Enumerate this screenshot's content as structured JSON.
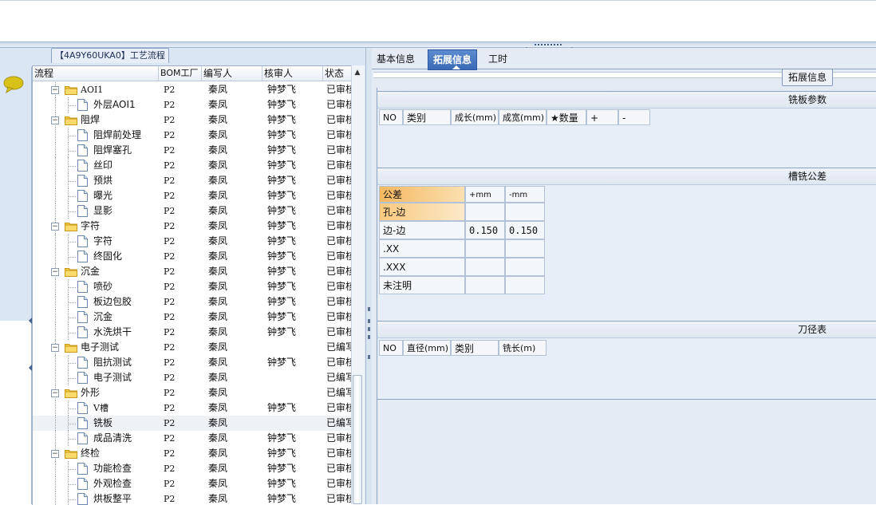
{
  "left_panel": {
    "legend_title": "【4A9Y60UKA0】工艺流程",
    "columns": [
      "流程",
      "BOM工厂",
      "编写人",
      "核审人",
      "状态"
    ],
    "rows": [
      {
        "level": 1,
        "type": "folder",
        "name": "AOI1",
        "bom": "P2",
        "writer": "秦凤",
        "reviewer": "钟梦飞",
        "status": "已审核"
      },
      {
        "level": 2,
        "type": "doc",
        "name": "外层AOI1",
        "bom": "P2",
        "writer": "秦凤",
        "reviewer": "钟梦飞",
        "status": "已审核"
      },
      {
        "level": 1,
        "type": "folder",
        "name": "阻焊",
        "bom": "P2",
        "writer": "秦凤",
        "reviewer": "钟梦飞",
        "status": "已审核"
      },
      {
        "level": 2,
        "type": "doc",
        "name": "阻焊前处理",
        "bom": "P2",
        "writer": "秦凤",
        "reviewer": "钟梦飞",
        "status": "已审核"
      },
      {
        "level": 2,
        "type": "doc",
        "name": "阻焊塞孔",
        "bom": "P2",
        "writer": "秦凤",
        "reviewer": "钟梦飞",
        "status": "已审核"
      },
      {
        "level": 2,
        "type": "doc",
        "name": "丝印",
        "bom": "P2",
        "writer": "秦凤",
        "reviewer": "钟梦飞",
        "status": "已审核"
      },
      {
        "level": 2,
        "type": "doc",
        "name": "预烘",
        "bom": "P2",
        "writer": "秦凤",
        "reviewer": "钟梦飞",
        "status": "已审核"
      },
      {
        "level": 2,
        "type": "doc",
        "name": "曝光",
        "bom": "P2",
        "writer": "秦凤",
        "reviewer": "钟梦飞",
        "status": "已审核"
      },
      {
        "level": 2,
        "type": "doc",
        "name": "显影",
        "bom": "P2",
        "writer": "秦凤",
        "reviewer": "钟梦飞",
        "status": "已审核"
      },
      {
        "level": 1,
        "type": "folder",
        "name": "字符",
        "bom": "P2",
        "writer": "秦凤",
        "reviewer": "钟梦飞",
        "status": "已审核"
      },
      {
        "level": 2,
        "type": "doc",
        "name": "字符",
        "bom": "P2",
        "writer": "秦凤",
        "reviewer": "钟梦飞",
        "status": "已审核"
      },
      {
        "level": 2,
        "type": "doc",
        "name": "终固化",
        "bom": "P2",
        "writer": "秦凤",
        "reviewer": "钟梦飞",
        "status": "已审核"
      },
      {
        "level": 1,
        "type": "folder",
        "name": "沉金",
        "bom": "P2",
        "writer": "秦凤",
        "reviewer": "钟梦飞",
        "status": "已审核"
      },
      {
        "level": 2,
        "type": "doc",
        "name": "喷砂",
        "bom": "P2",
        "writer": "秦凤",
        "reviewer": "钟梦飞",
        "status": "已审核"
      },
      {
        "level": 2,
        "type": "doc",
        "name": "板边包胶",
        "bom": "P2",
        "writer": "秦凤",
        "reviewer": "钟梦飞",
        "status": "已审核"
      },
      {
        "level": 2,
        "type": "doc",
        "name": "沉金",
        "bom": "P2",
        "writer": "秦凤",
        "reviewer": "钟梦飞",
        "status": "已审核"
      },
      {
        "level": 2,
        "type": "doc",
        "name": "水洗烘干",
        "bom": "P2",
        "writer": "秦凤",
        "reviewer": "钟梦飞",
        "status": "已审核"
      },
      {
        "level": 1,
        "type": "folder",
        "name": "电子测试",
        "bom": "P2",
        "writer": "秦凤",
        "reviewer": "",
        "status": "已编写"
      },
      {
        "level": 2,
        "type": "doc",
        "name": "阻抗测试",
        "bom": "P2",
        "writer": "秦凤",
        "reviewer": "钟梦飞",
        "status": "已审核"
      },
      {
        "level": 2,
        "type": "doc",
        "name": "电子测试",
        "bom": "P2",
        "writer": "秦凤",
        "reviewer": "",
        "status": "已编写"
      },
      {
        "level": 1,
        "type": "folder",
        "name": "外形",
        "bom": "P2",
        "writer": "秦凤",
        "reviewer": "",
        "status": "已编写"
      },
      {
        "level": 2,
        "type": "doc",
        "name": "V槽",
        "bom": "P2",
        "writer": "秦凤",
        "reviewer": "钟梦飞",
        "status": "已审核"
      },
      {
        "level": 2,
        "type": "doc",
        "name": "铣板",
        "bom": "P2",
        "writer": "秦凤",
        "reviewer": "",
        "status": "已编写",
        "selected": true
      },
      {
        "level": 2,
        "type": "doc",
        "name": "成品清洗",
        "bom": "P2",
        "writer": "秦凤",
        "reviewer": "钟梦飞",
        "status": "已审核"
      },
      {
        "level": 1,
        "type": "folder",
        "name": "终检",
        "bom": "P2",
        "writer": "秦凤",
        "reviewer": "钟梦飞",
        "status": "已审核"
      },
      {
        "level": 2,
        "type": "doc",
        "name": "功能检查",
        "bom": "P2",
        "writer": "秦凤",
        "reviewer": "钟梦飞",
        "status": "已审核"
      },
      {
        "level": 2,
        "type": "doc",
        "name": "外观检查",
        "bom": "P2",
        "writer": "秦凤",
        "reviewer": "钟梦飞",
        "status": "已审核"
      },
      {
        "level": 2,
        "type": "doc",
        "name": "烘板整平",
        "bom": "P2",
        "writer": "秦凤",
        "reviewer": "钟梦飞",
        "status": "已审核"
      }
    ]
  },
  "right_panel": {
    "tabs": [
      {
        "label": "基本信息",
        "active": false
      },
      {
        "label": "拓展信息",
        "active": true
      },
      {
        "label": "工时",
        "active": false
      }
    ],
    "legend": "拓展信息",
    "milling_params": {
      "title": "铣板参数",
      "columns": [
        "NO",
        "类别",
        "成长(mm)",
        "成宽(mm)",
        "★数量",
        "+",
        "-"
      ]
    },
    "slot_tolerance": {
      "title": "槽铣公差",
      "header": [
        "公差",
        "+mm",
        "-mm"
      ],
      "rows": [
        {
          "name": "孔-边",
          "plus": "",
          "minus": ""
        },
        {
          "name": "边-边",
          "plus": "0.150",
          "minus": "0.150"
        },
        {
          "name": ".XX",
          "plus": "",
          "minus": ""
        },
        {
          "name": ".XXX",
          "plus": "",
          "minus": ""
        },
        {
          "name": "未注明",
          "plus": "",
          "minus": ""
        }
      ]
    },
    "tool_table": {
      "title": "刀径表",
      "columns": [
        "NO",
        "直径(mm)",
        "类别",
        "铣长(m)"
      ]
    }
  },
  "colors": {
    "active_tab": "#3a6ab5",
    "panel_bg": "#e4ebf5",
    "highlight": "#f5b860"
  }
}
